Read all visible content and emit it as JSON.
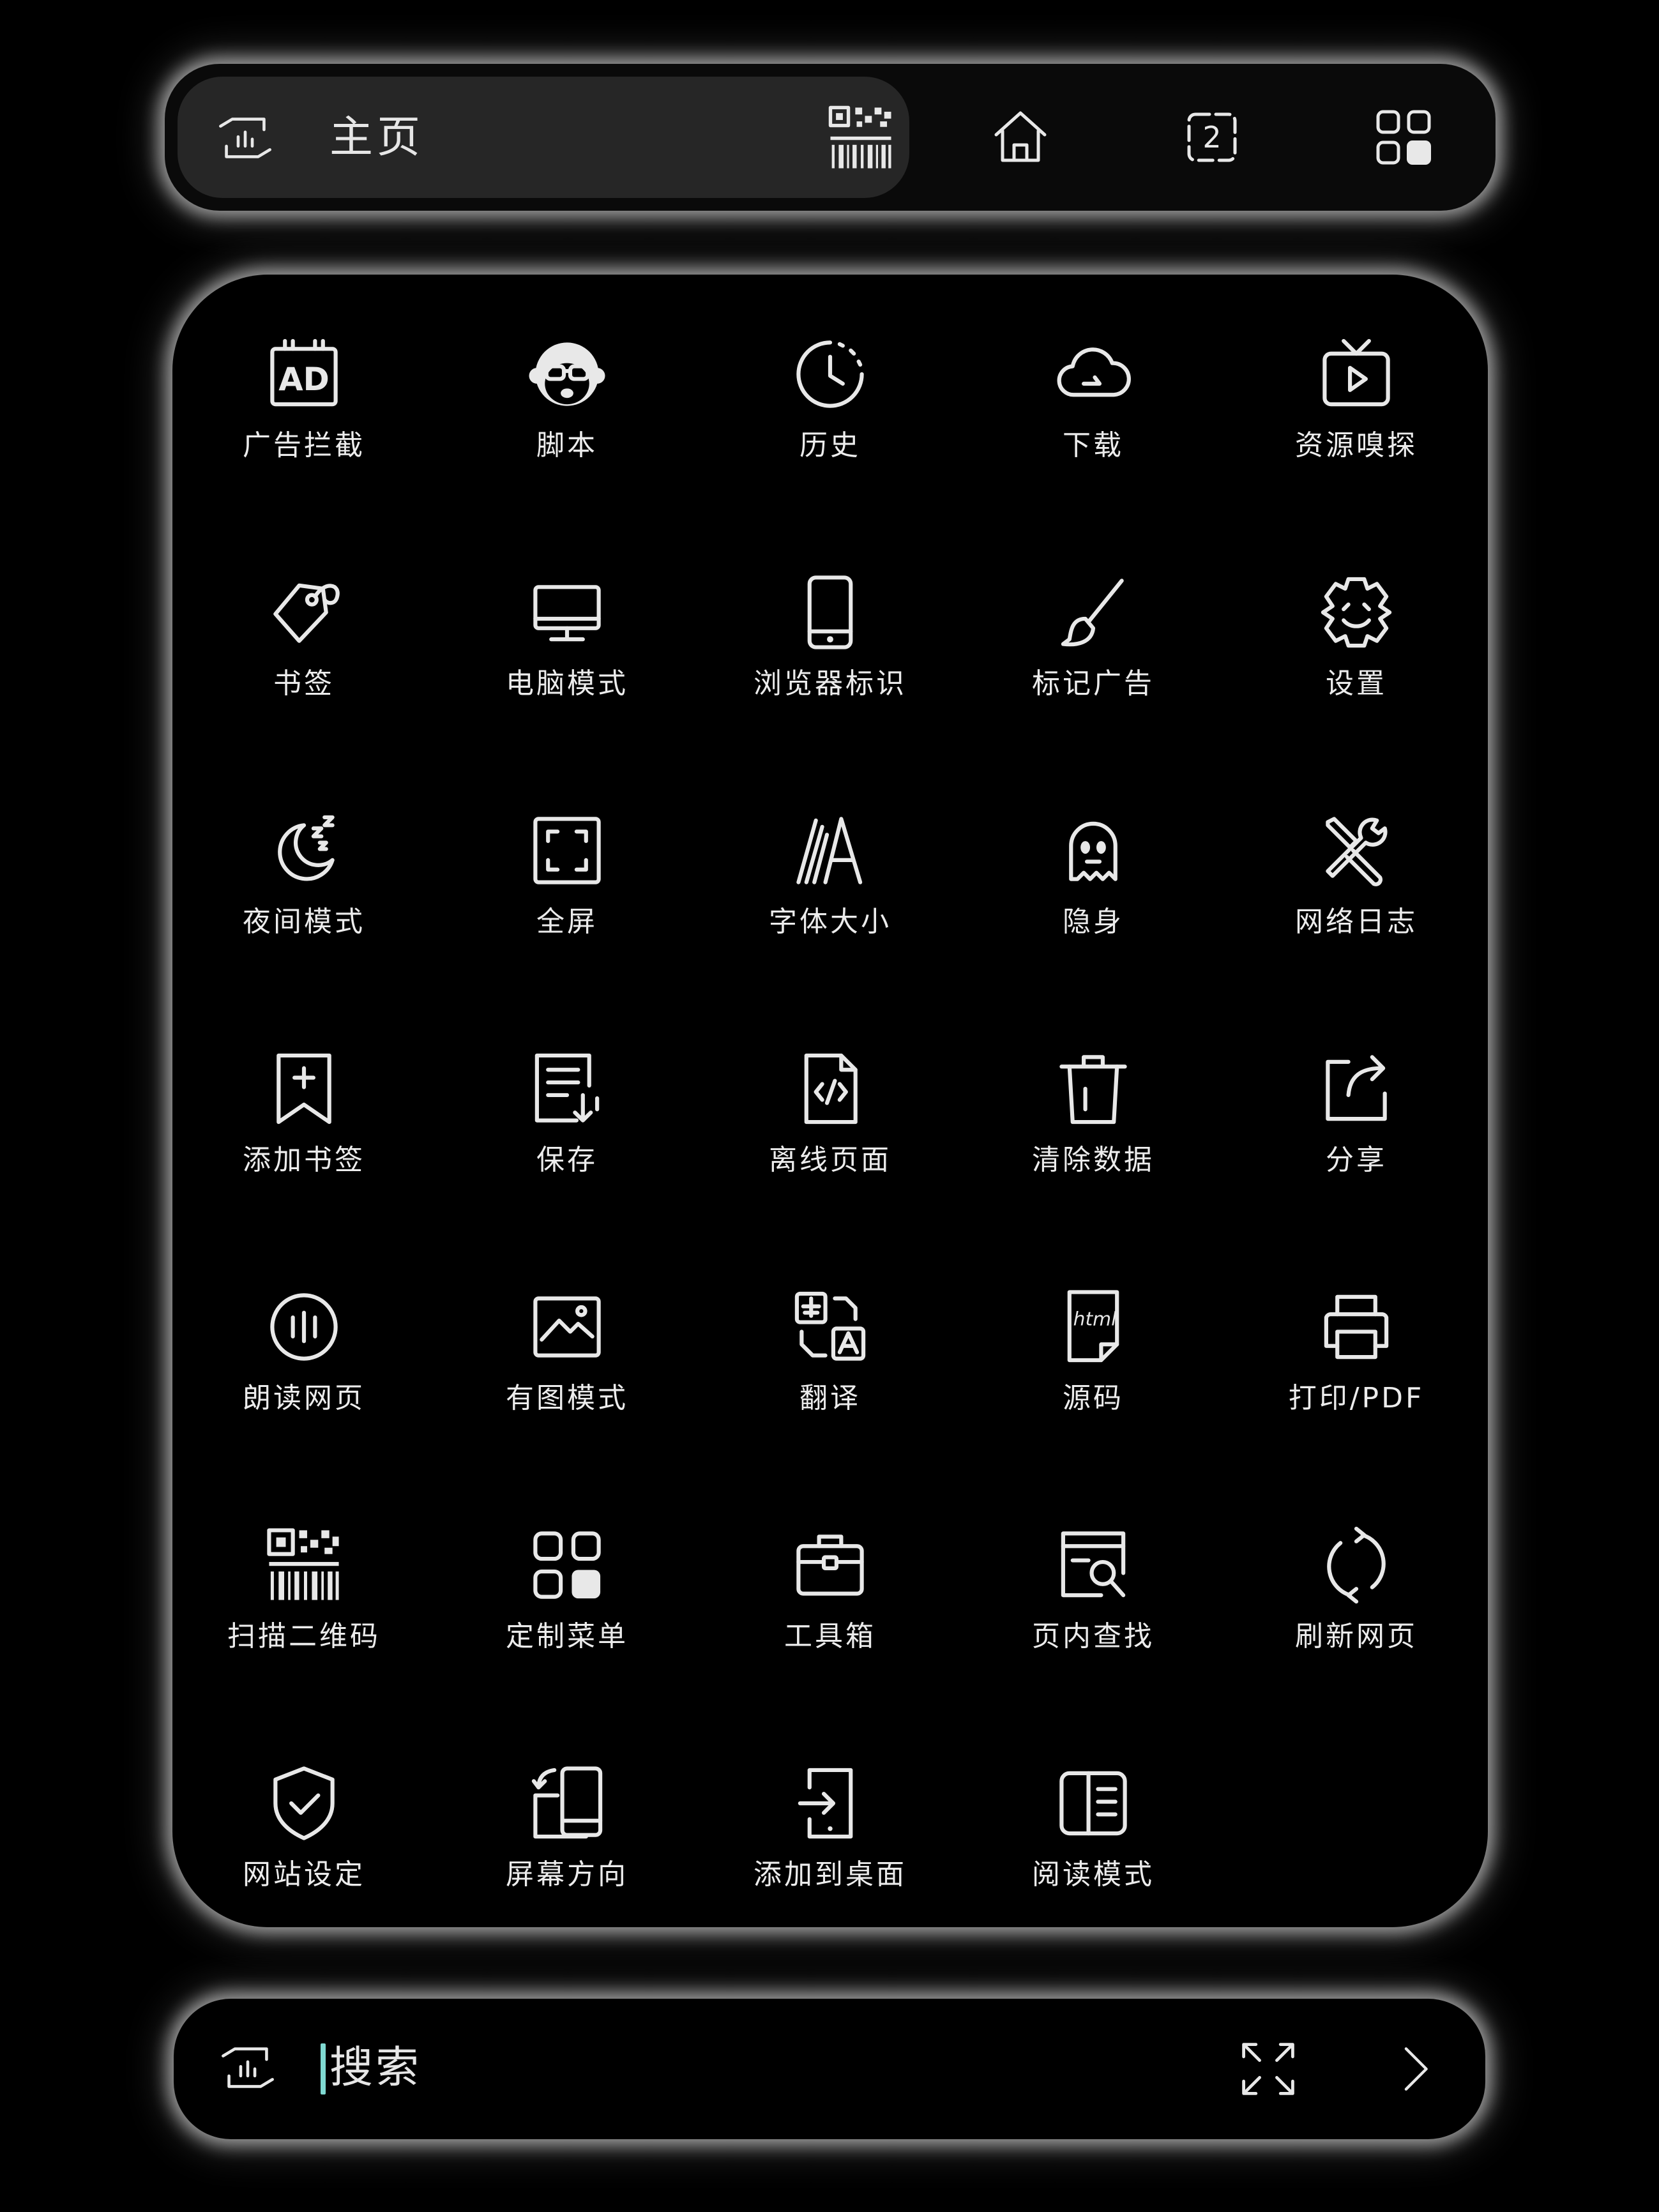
{
  "address_bar": {
    "title": "主页"
  },
  "menu": {
    "items": [
      {
        "label": "广告拦截",
        "icon": "ad-block-icon"
      },
      {
        "label": "脚本",
        "icon": "monkey-script-icon"
      },
      {
        "label": "历史",
        "icon": "history-icon"
      },
      {
        "label": "下载",
        "icon": "cloud-download-icon"
      },
      {
        "label": "资源嗅探",
        "icon": "resource-sniff-icon"
      },
      {
        "label": "书签",
        "icon": "bookmark-tag-icon"
      },
      {
        "label": "电脑模式",
        "icon": "desktop-icon"
      },
      {
        "label": "浏览器标识",
        "icon": "phone-icon"
      },
      {
        "label": "标记广告",
        "icon": "brush-icon"
      },
      {
        "label": "设置",
        "icon": "gear-icon"
      },
      {
        "label": "夜间模式",
        "icon": "moon-icon"
      },
      {
        "label": "全屏",
        "icon": "fullscreen-icon"
      },
      {
        "label": "字体大小",
        "icon": "font-size-icon"
      },
      {
        "label": "隐身",
        "icon": "ghost-icon"
      },
      {
        "label": "网络日志",
        "icon": "tools-icon"
      },
      {
        "label": "添加书签",
        "icon": "add-bookmark-icon"
      },
      {
        "label": "保存",
        "icon": "save-icon"
      },
      {
        "label": "离线页面",
        "icon": "code-file-icon"
      },
      {
        "label": "清除数据",
        "icon": "trash-icon"
      },
      {
        "label": "分享",
        "icon": "share-icon"
      },
      {
        "label": "朗读网页",
        "icon": "read-aloud-icon"
      },
      {
        "label": "有图模式",
        "icon": "image-icon"
      },
      {
        "label": "翻译",
        "icon": "translate-icon"
      },
      {
        "label": "源码",
        "icon": "html-icon"
      },
      {
        "label": "打印/PDF",
        "icon": "printer-icon"
      },
      {
        "label": "扫描二维码",
        "icon": "qr-scan-icon"
      },
      {
        "label": "定制菜单",
        "icon": "grid-menu-icon"
      },
      {
        "label": "工具箱",
        "icon": "toolbox-icon"
      },
      {
        "label": "页内查找",
        "icon": "find-in-page-icon"
      },
      {
        "label": "刷新网页",
        "icon": "refresh-icon"
      },
      {
        "label": "网站设定",
        "icon": "shield-icon"
      },
      {
        "label": "屏幕方向",
        "icon": "rotate-screen-icon"
      },
      {
        "label": "添加到桌面",
        "icon": "add-to-desktop-icon"
      },
      {
        "label": "阅读模式",
        "icon": "reader-mode-icon"
      }
    ]
  },
  "top_bar": {
    "tab_count": "2"
  },
  "search_bar": {
    "placeholder": "搜索"
  },
  "colors": {
    "background": "#000000",
    "address_bg": "#262626",
    "text": "#e8e8e8",
    "cursor": "#7fd9d1",
    "glow": "#ffffff"
  }
}
